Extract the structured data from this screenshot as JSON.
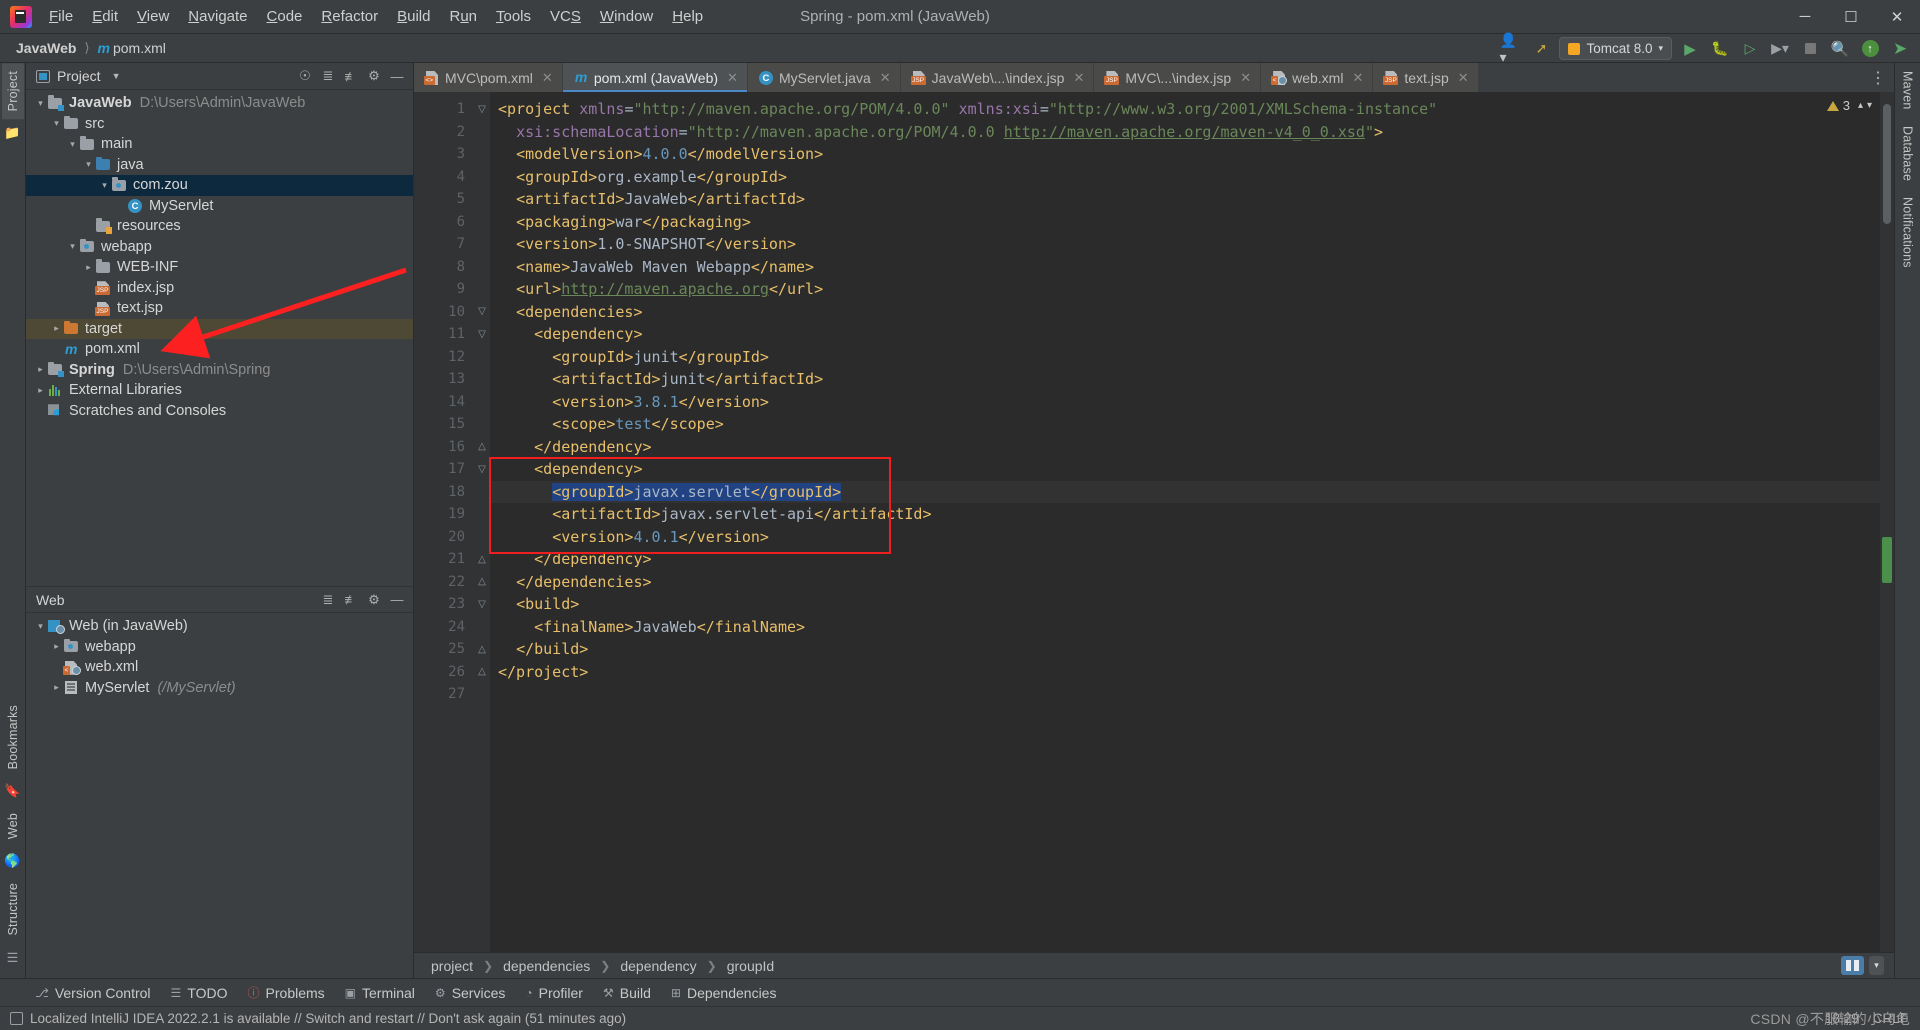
{
  "window": {
    "title": "Spring - pom.xml (JavaWeb)",
    "logo_icon": "intellij-idea-logo",
    "minimize_icon": "minimize-icon",
    "maximize_icon": "maximize-icon",
    "close_icon": "close-icon"
  },
  "menubar": {
    "items": [
      "File",
      "Edit",
      "View",
      "Navigate",
      "Code",
      "Refactor",
      "Build",
      "Run",
      "Tools",
      "VCS",
      "Window",
      "Help"
    ]
  },
  "navbar": {
    "breadcrumbs": [
      {
        "label": "JavaWeb",
        "icon": ""
      },
      {
        "label": "pom.xml",
        "icon": "maven-m-icon"
      }
    ],
    "separator": "〉",
    "run_config": "Tomcat 8.0",
    "icons": {
      "avatar": "user-avatar-icon",
      "updates": "arrow-up-update-icon",
      "tomcat": "tomcat-icon",
      "dropdown": "chevron-down-icon",
      "run": "run-icon",
      "debug": "debug-icon",
      "run_with_coverage": "run-coverage-icon",
      "more_run": "chevron-down-icon",
      "stop": "stop-icon",
      "search": "search-icon",
      "update_badge": "update-available-icon",
      "ide_play": "ide-run-icon"
    }
  },
  "left_rail": {
    "top": [
      "Project"
    ],
    "top_icon": "folder-icon",
    "bottom": [
      "Bookmarks",
      "Web",
      "Structure"
    ],
    "bottom_icons": [
      "bookmark-icon",
      "web-icon",
      "structure-icon"
    ]
  },
  "right_rail": {
    "items": [
      "Maven",
      "Database",
      "Notifications"
    ]
  },
  "project_panel": {
    "title": "Project",
    "caret": "▾",
    "tools": [
      "locate-icon",
      "expand-all-icon",
      "collapse-all-icon",
      "settings-gear-icon",
      "hide-icon"
    ],
    "tree": [
      {
        "depth": 0,
        "arrow": "⌄",
        "icon": "module-folder-icon",
        "label": "JavaWeb",
        "bold": true,
        "sub": "D:\\Users\\Admin\\JavaWeb"
      },
      {
        "depth": 1,
        "arrow": "⌄",
        "icon": "folder-icon",
        "label": "src"
      },
      {
        "depth": 2,
        "arrow": "⌄",
        "icon": "folder-icon",
        "label": "main"
      },
      {
        "depth": 3,
        "arrow": "⌄",
        "icon": "source-folder-icon",
        "label": "java"
      },
      {
        "depth": 4,
        "arrow": "⌄",
        "icon": "package-icon",
        "label": "com.zou",
        "selected": true
      },
      {
        "depth": 5,
        "arrow": "",
        "icon": "java-class-icon",
        "label": "MyServlet"
      },
      {
        "depth": 3,
        "arrow": "",
        "icon": "resources-folder-icon",
        "label": "resources"
      },
      {
        "depth": 2,
        "arrow": "⌄",
        "icon": "webapp-folder-icon",
        "label": "webapp"
      },
      {
        "depth": 3,
        "arrow": "›",
        "icon": "folder-icon",
        "label": "WEB-INF"
      },
      {
        "depth": 3,
        "arrow": "",
        "icon": "jsp-file-icon",
        "label": "index.jsp"
      },
      {
        "depth": 3,
        "arrow": "",
        "icon": "jsp-file-icon",
        "label": "text.jsp"
      },
      {
        "depth": 1,
        "arrow": "›",
        "icon": "target-folder-icon",
        "label": "target",
        "highlight": true
      },
      {
        "depth": 1,
        "arrow": "",
        "icon": "maven-m-icon",
        "label": "pom.xml"
      },
      {
        "depth": 0,
        "arrow": "›",
        "icon": "module-folder-icon",
        "label": "Spring",
        "bold": true,
        "sub": "D:\\Users\\Admin\\Spring"
      },
      {
        "depth": 0,
        "arrow": "›",
        "icon": "external-libraries-icon",
        "label": "External Libraries"
      },
      {
        "depth": 0,
        "arrow": "",
        "icon": "scratches-icon",
        "label": "Scratches and Consoles"
      }
    ]
  },
  "web_panel": {
    "title": "Web",
    "tools": [
      "expand-all-icon",
      "collapse-all-icon",
      "settings-gear-icon",
      "hide-icon"
    ],
    "tree": [
      {
        "depth": 0,
        "arrow": "⌄",
        "icon": "web-module-icon",
        "label": "Web (in JavaWeb)"
      },
      {
        "depth": 1,
        "arrow": "›",
        "icon": "webapp-folder-icon",
        "label": "webapp"
      },
      {
        "depth": 1,
        "arrow": "",
        "icon": "web-xml-icon",
        "label": "web.xml"
      },
      {
        "depth": 1,
        "arrow": "›",
        "icon": "servlet-icon",
        "label": "MyServlet",
        "sub": "(/MyServlet)"
      }
    ]
  },
  "editor_tabs": {
    "items": [
      {
        "label": "MVC\\pom.xml",
        "icon": "xml-file-icon",
        "active": false
      },
      {
        "label": "pom.xml (JavaWeb)",
        "icon": "maven-m-icon",
        "active": true
      },
      {
        "label": "MyServlet.java",
        "icon": "java-class-icon",
        "active": false
      },
      {
        "label": "JavaWeb\\...\\index.jsp",
        "icon": "jsp-file-icon",
        "active": false
      },
      {
        "label": "MVC\\...\\index.jsp",
        "icon": "jsp-file-icon",
        "active": false
      },
      {
        "label": "web.xml",
        "icon": "web-xml-icon",
        "active": false
      },
      {
        "label": "text.jsp",
        "icon": "jsp-file-icon",
        "active": false
      }
    ],
    "close_icon": "close-icon",
    "overflow_icon": "more-options-icon"
  },
  "inspections": {
    "count": "3",
    "warning_icon": "warning-triangle-icon",
    "chevron": "chevron-down-icon",
    "chevron_up": "chevron-up-icon"
  },
  "code": {
    "line_count": 27,
    "current_line": 18,
    "bulb_icon": "intention-bulb-icon",
    "lines": [
      {
        "n": 1,
        "fold": "▽",
        "html": "<span class=\"t-tag\">&lt;project</span> <span class=\"t-attrn\">xmlns</span><span class=\"t-plain\">=</span><span class=\"t-str\">\"http://maven.apache.org/POM/4.0.0\"</span> <span class=\"t-attrn\">xmlns:xsi</span><span class=\"t-plain\">=</span><span class=\"t-str\">\"http://www.w3.org/2001/XMLSchema-instance\"</span>"
      },
      {
        "n": 2,
        "fold": "",
        "html": "  <span class=\"t-attrn\">xsi:schemaLocation</span><span class=\"t-plain\">=</span><span class=\"t-str\">\"http://maven.apache.org/POM/4.0.0 </span><span class=\"t-link\">http://maven.apache.org/maven-v4_0_0.xsd</span><span class=\"t-str\">\"</span><span class=\"t-tag\">&gt;</span>"
      },
      {
        "n": 3,
        "fold": "",
        "html": "  <span class=\"t-tag\">&lt;modelVersion&gt;</span><span class=\"t-num\">4.0.0</span><span class=\"t-tag\">&lt;/modelVersion&gt;</span>"
      },
      {
        "n": 4,
        "fold": "",
        "html": "  <span class=\"t-tag\">&lt;groupId&gt;</span><span class=\"t-val\">org.example</span><span class=\"t-tag\">&lt;/groupId&gt;</span>"
      },
      {
        "n": 5,
        "fold": "",
        "html": "  <span class=\"t-tag\">&lt;artifactId&gt;</span><span class=\"t-val\">JavaWeb</span><span class=\"t-tag\">&lt;/artifactId&gt;</span>"
      },
      {
        "n": 6,
        "fold": "",
        "html": "  <span class=\"t-tag\">&lt;packaging&gt;</span><span class=\"t-val\">war</span><span class=\"t-tag\">&lt;/packaging&gt;</span>"
      },
      {
        "n": 7,
        "fold": "",
        "html": "  <span class=\"t-tag\">&lt;version&gt;</span><span class=\"t-val\">1.0-SNAPSHOT</span><span class=\"t-tag\">&lt;/version&gt;</span>"
      },
      {
        "n": 8,
        "fold": "",
        "html": "  <span class=\"t-tag\">&lt;name&gt;</span><span class=\"t-val\">JavaWeb Maven Webapp</span><span class=\"t-tag\">&lt;/name&gt;</span>"
      },
      {
        "n": 9,
        "fold": "",
        "html": "  <span class=\"t-tag\">&lt;url&gt;</span><span class=\"t-link\">http://maven.apache.org</span><span class=\"t-tag\">&lt;/url&gt;</span>"
      },
      {
        "n": 10,
        "fold": "▽",
        "html": "  <span class=\"t-tag\">&lt;dependencies&gt;</span>"
      },
      {
        "n": 11,
        "fold": "▽",
        "html": "    <span class=\"t-tag\">&lt;dependency&gt;</span>"
      },
      {
        "n": 12,
        "fold": "",
        "html": "      <span class=\"t-tag\">&lt;groupId&gt;</span><span class=\"t-val\">junit</span><span class=\"t-tag\">&lt;/groupId&gt;</span>"
      },
      {
        "n": 13,
        "fold": "",
        "html": "      <span class=\"t-tag\">&lt;artifactId&gt;</span><span class=\"t-val\">junit</span><span class=\"t-tag\">&lt;/artifactId&gt;</span>"
      },
      {
        "n": 14,
        "fold": "",
        "html": "      <span class=\"t-tag\">&lt;version&gt;</span><span class=\"t-num\">3.8.1</span><span class=\"t-tag\">&lt;/version&gt;</span>"
      },
      {
        "n": 15,
        "fold": "",
        "html": "      <span class=\"t-tag\">&lt;scope&gt;</span><span class=\"t-num\">test</span><span class=\"t-tag\">&lt;/scope&gt;</span>"
      },
      {
        "n": 16,
        "fold": "△",
        "html": "    <span class=\"t-tag\">&lt;/dependency&gt;</span>"
      },
      {
        "n": 17,
        "fold": "▽",
        "html": "    <span class=\"t-tag\">&lt;dependency&gt;</span>"
      },
      {
        "n": 18,
        "fold": "",
        "current": true,
        "html": "      <span class=\"sel-hl\"><span class=\"t-tag\">&lt;groupId&gt;</span><span class=\"t-val\">javax.servlet</span><span class=\"t-tag\">&lt;/groupId&gt;</span></span>"
      },
      {
        "n": 19,
        "fold": "",
        "html": "      <span class=\"t-tag\">&lt;artifactId&gt;</span><span class=\"t-val\">javax.servlet-api</span><span class=\"t-tag\">&lt;/artifactId&gt;</span>"
      },
      {
        "n": 20,
        "fold": "",
        "html": "      <span class=\"t-tag\">&lt;version&gt;</span><span class=\"t-num\">4.0.1</span><span class=\"t-tag\">&lt;/version&gt;</span>"
      },
      {
        "n": 21,
        "fold": "△",
        "html": "    <span class=\"t-tag\">&lt;/dependency&gt;</span>"
      },
      {
        "n": 22,
        "fold": "△",
        "html": "  <span class=\"t-tag\">&lt;/dependencies&gt;</span>"
      },
      {
        "n": 23,
        "fold": "▽",
        "html": "  <span class=\"t-tag\">&lt;build&gt;</span>"
      },
      {
        "n": 24,
        "fold": "",
        "html": "    <span class=\"t-tag\">&lt;finalName&gt;</span><span class=\"t-val\">JavaWeb</span><span class=\"t-tag\">&lt;/finalName&gt;</span>"
      },
      {
        "n": 25,
        "fold": "△",
        "html": "  <span class=\"t-tag\">&lt;/build&gt;</span>"
      },
      {
        "n": 26,
        "fold": "△",
        "html": "<span class=\"t-tag\">&lt;/project&gt;</span>"
      },
      {
        "n": 27,
        "fold": "",
        "html": ""
      }
    ]
  },
  "editor_breadcrumb": {
    "items": [
      "project",
      "dependencies",
      "dependency",
      "groupId"
    ],
    "separator": "〉",
    "layout_icon": "editor-layout-icon",
    "more_icon": "chevron-down-icon"
  },
  "bottom_toolwindows": [
    {
      "label": "Version Control",
      "icon": "version-control-icon"
    },
    {
      "label": "TODO",
      "icon": "todo-list-icon"
    },
    {
      "label": "Problems",
      "icon": "problems-icon"
    },
    {
      "label": "Terminal",
      "icon": "terminal-icon"
    },
    {
      "label": "Services",
      "icon": "services-icon"
    },
    {
      "label": "Profiler",
      "icon": "profiler-icon"
    },
    {
      "label": "Build",
      "icon": "build-hammer-icon"
    },
    {
      "label": "Dependencies",
      "icon": "dependencies-icon"
    }
  ],
  "statusbar": {
    "message": "Localized IntelliJ IDEA 2022.2.1 is available // Switch and restart // Don't ask again (51 minutes ago)",
    "icon": "event-log-icon",
    "time": "18:29",
    "line_sep": "CRLF",
    "watermark": "CSDN @不服输的小乌龟"
  },
  "annotations": {
    "arrow_color": "#fc2020",
    "box_color": "#f01f1f",
    "arrow_name": "red-pointer-arrow",
    "box_name": "red-highlight-box"
  },
  "colors": {
    "accent": "#4a88c7",
    "selection": "#0d293e",
    "editor_bg": "#2b2b2b",
    "chrome_bg": "#3c3f41"
  }
}
